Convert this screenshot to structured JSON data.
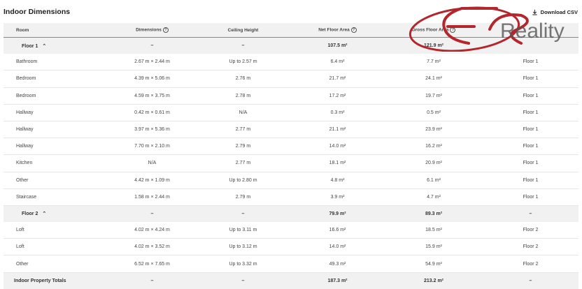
{
  "title": "Indoor Dimensions",
  "download_label": "Download CSV",
  "headers": [
    "Room",
    "Dimensions",
    "Ceiling Height",
    "Net Floor Area",
    "Gross Floor Area",
    ""
  ],
  "floor1": {
    "label": "Floor 1",
    "summary": [
      "–",
      "–",
      "107.5 m²",
      "121.9 m²",
      ""
    ],
    "rows": [
      [
        "Bathroom",
        "2.67 m × 2.44 m",
        "Up to 2.57 m",
        "6.4 m²",
        "7.7 m²",
        "Floor 1"
      ],
      [
        "Bedroom",
        "4.39 m × 5.06 m",
        "2.76 m",
        "21.7 m²",
        "24.1 m²",
        "Floor 1"
      ],
      [
        "Bedroom",
        "4.59 m × 3.75 m",
        "2.78 m",
        "17.2 m²",
        "19.7 m²",
        "Floor 1"
      ],
      [
        "Hallway",
        "0.42 m × 0.61 m",
        "N/A",
        "0.3 m²",
        "0.5 m²",
        "Floor 1"
      ],
      [
        "Hallway",
        "3.97 m × 5.36 m",
        "2.77 m",
        "21.1 m²",
        "23.9 m²",
        "Floor 1"
      ],
      [
        "Hallway",
        "7.70 m × 2.10 m",
        "2.79 m",
        "14.0 m²",
        "16.2 m²",
        "Floor 1"
      ],
      [
        "Kitchen",
        "N/A",
        "2.77 m",
        "18.1 m²",
        "20.9 m²",
        "Floor 1"
      ],
      [
        "Other",
        "4.42 m × 1.09 m",
        "Up to 2.80 m",
        "4.8 m²",
        "6.1 m²",
        "Floor 1"
      ],
      [
        "Staircase",
        "1.58 m × 2.44 m",
        "2.79 m",
        "3.9 m²",
        "4.7 m²",
        "Floor 1"
      ]
    ]
  },
  "floor2": {
    "label": "Floor 2",
    "summary": [
      "–",
      "–",
      "79.9 m²",
      "89.3 m²",
      "–"
    ],
    "rows": [
      [
        "Loft",
        "4.02 m × 4.24 m",
        "Up to 3.11 m",
        "16.6 m²",
        "18.5 m²",
        "Floor 2"
      ],
      [
        "Loft",
        "4.02 m × 3.52 m",
        "Up to 3.12 m",
        "14.0 m²",
        "15.9 m²",
        "Floor 2"
      ],
      [
        "Other",
        "6.52 m × 7.65 m",
        "Up to 3.32 m",
        "49.3 m²",
        "54.9 m²",
        "Floor 2"
      ]
    ]
  },
  "totals": {
    "label": "Indoor Property Totals",
    "values": [
      "–",
      "–",
      "187.3 m²",
      "213.2 m²",
      "–"
    ]
  },
  "watermark": {
    "text": "Reality",
    "color": "#b3262c"
  }
}
